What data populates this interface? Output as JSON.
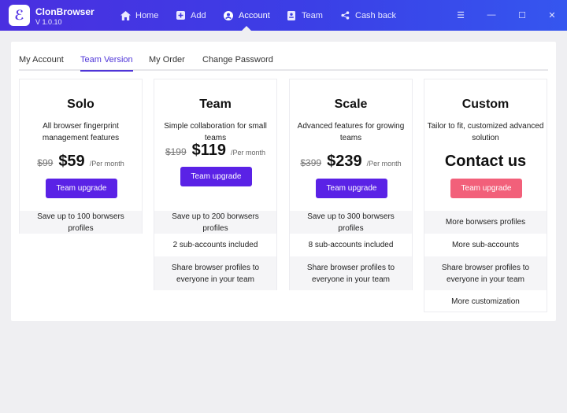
{
  "app": {
    "name": "ClonBrowser",
    "version": "V 1.0.10",
    "logo_glyph": "ℰ"
  },
  "nav": [
    {
      "label": "Home",
      "icon": "home-icon"
    },
    {
      "label": "Add",
      "icon": "plus-square-icon"
    },
    {
      "label": "Account",
      "icon": "user-circle-icon",
      "active": true
    },
    {
      "label": "Team",
      "icon": "id-card-icon"
    },
    {
      "label": "Cash back",
      "icon": "share-icon"
    }
  ],
  "window_controls": {
    "menu": "☰",
    "minimize": "—",
    "maximize": "☐",
    "close": "✕"
  },
  "tabs": [
    {
      "label": "My Account"
    },
    {
      "label": "Team Version",
      "active": true
    },
    {
      "label": "My Order"
    },
    {
      "label": "Change Password"
    }
  ],
  "plans": [
    {
      "title": "Solo",
      "desc": "All browser fingerprint management features",
      "old_price": "$99",
      "price": "$59",
      "per": "/Per month",
      "button": "Team upgrade",
      "features": [
        "Save up to 100 borwsers profiles"
      ]
    },
    {
      "title": "Team",
      "desc": "Simple collaboration for small teams",
      "old_price": "$199",
      "price": "$119",
      "per": "/Per month",
      "button": "Team upgrade",
      "features": [
        "Save up to 200 borwsers profiles",
        "2 sub-accounts included",
        "Share browser profiles to everyone in your team"
      ]
    },
    {
      "title": "Scale",
      "desc": "Advanced features for growing teams",
      "old_price": "$399",
      "price": "$239",
      "per": "/Per month",
      "button": "Team upgrade",
      "features": [
        "Save up to 300 borwsers profiles",
        "8 sub-accounts included",
        "Share browser profiles to everyone in your team"
      ]
    },
    {
      "title": "Custom",
      "desc": "Tailor to fit, customized advanced solution",
      "contact": "Contact us",
      "button": "Team upgrade",
      "features": [
        "More borwsers profiles",
        "More sub-accounts",
        "Share browser profiles to everyone in your team",
        "More customization"
      ]
    }
  ],
  "colors": {
    "accent": "#5a22e6",
    "topbar": "#3b3fe6",
    "custom_button": "#f2607a",
    "tab_active": "#4f35d8"
  }
}
